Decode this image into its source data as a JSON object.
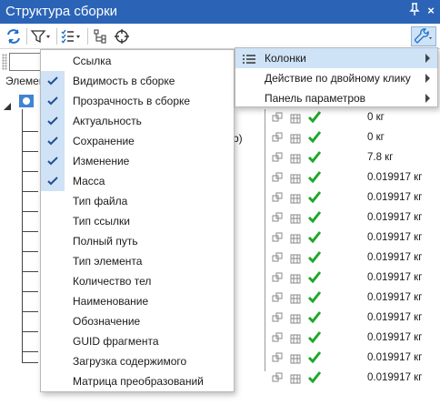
{
  "window": {
    "title": "Структура сборки",
    "pin_glyph": "ф",
    "close_glyph": "×"
  },
  "tree": {
    "column_header": "Элемен"
  },
  "columns_menu": {
    "items": [
      {
        "label": "Ссылка",
        "checked": false
      },
      {
        "label": "Видимость в сборке",
        "checked": true
      },
      {
        "label": "Прозрачность в сборке",
        "checked": true
      },
      {
        "label": "Актуальность",
        "checked": true
      },
      {
        "label": "Сохранение",
        "checked": true
      },
      {
        "label": "Изменение",
        "checked": true
      },
      {
        "label": "Масса",
        "checked": true
      },
      {
        "label": "Тип файла",
        "checked": false
      },
      {
        "label": "Тип ссылки",
        "checked": false
      },
      {
        "label": "Полный путь",
        "checked": false
      },
      {
        "label": "Тип элемента",
        "checked": false
      },
      {
        "label": "Количество тел",
        "checked": false
      },
      {
        "label": "Наименование",
        "checked": false
      },
      {
        "label": "Обозначение",
        "checked": false
      },
      {
        "label": "GUID фрагмента",
        "checked": false
      },
      {
        "label": "Загрузка содержимого",
        "checked": false
      },
      {
        "label": "Матрица преобразований",
        "checked": false
      }
    ]
  },
  "settings_menu": {
    "items": [
      {
        "label": "Колонки",
        "submenu": true,
        "highlighted": true
      },
      {
        "label": "Действие по двойному клику",
        "submenu": true,
        "highlighted": false
      },
      {
        "label": "Панель параметров",
        "submenu": true,
        "highlighted": false
      }
    ]
  },
  "rows": [
    {
      "mass": "0 кг"
    },
    {
      "mass": "0 кг",
      "extra": "b)"
    },
    {
      "mass": "7.8 кг"
    },
    {
      "mass": "0.019917 кг"
    },
    {
      "mass": "0.019917 кг"
    },
    {
      "mass": "0.019917 кг"
    },
    {
      "mass": "0.019917 кг"
    },
    {
      "mass": "0.019917 кг"
    },
    {
      "mass": "0.019917 кг"
    },
    {
      "mass": "0.019917 кг"
    },
    {
      "mass": "0.019917 кг"
    },
    {
      "mass": "0.019917 кг"
    },
    {
      "mass": "0.019917 кг"
    },
    {
      "mass": "0.019917 кг"
    }
  ],
  "colors": {
    "titlebar": "#2b64b7",
    "menu_highlight": "#cfe3f7",
    "check_column": "#cfe2f6",
    "status_ok": "#1ea82b"
  }
}
